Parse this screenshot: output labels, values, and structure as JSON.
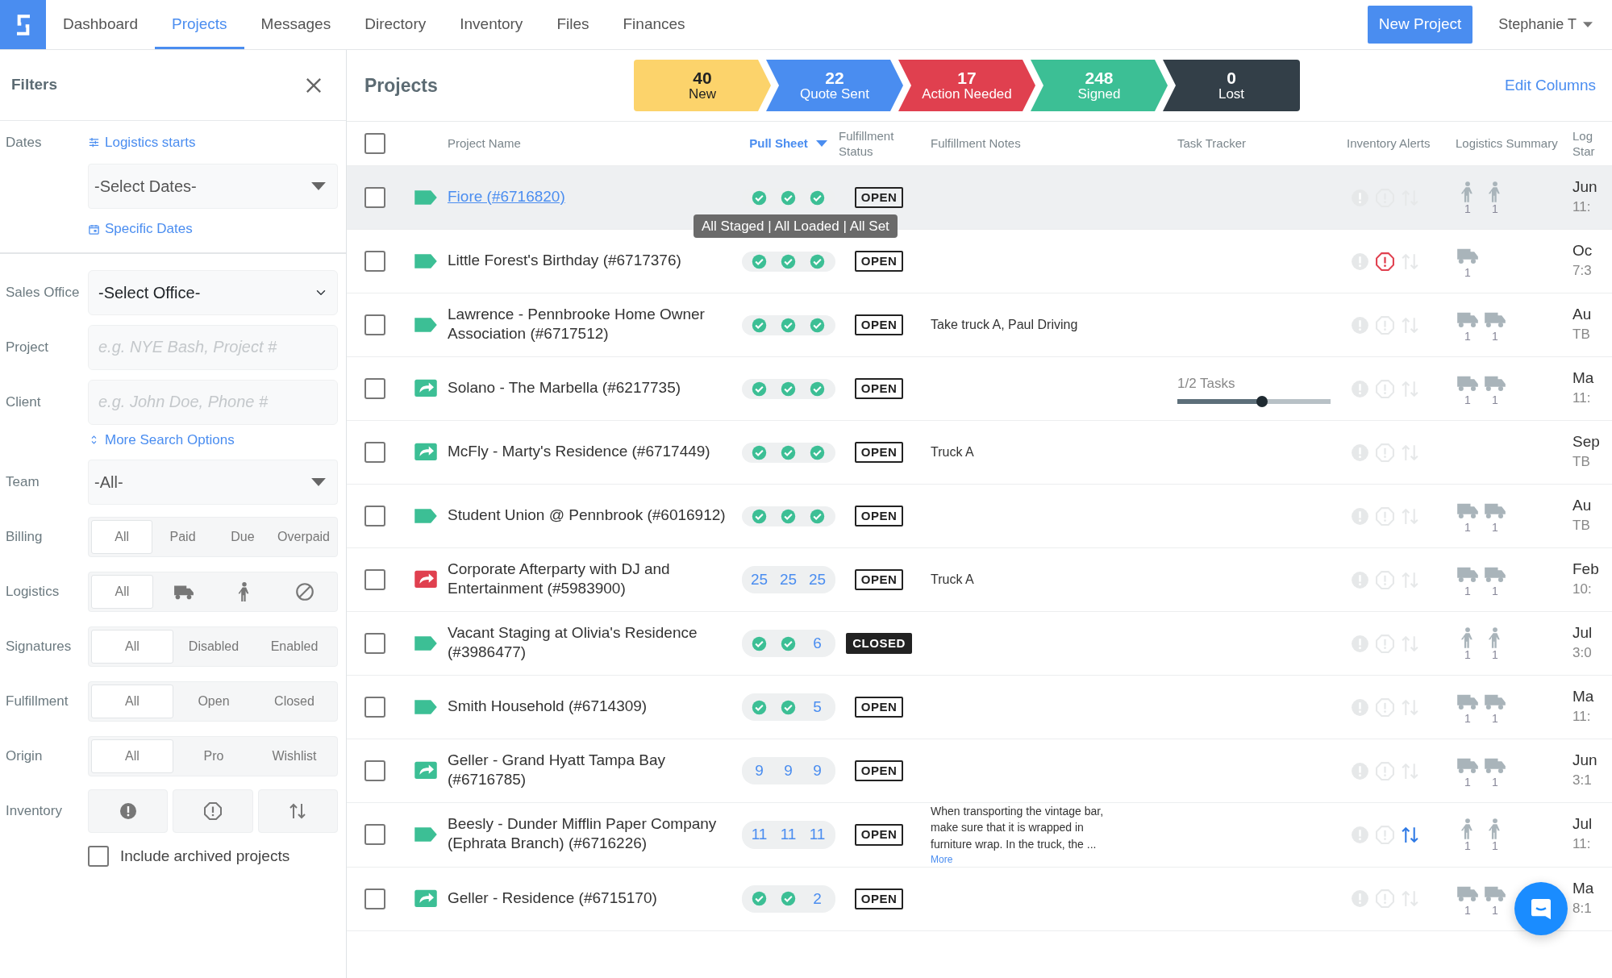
{
  "nav": {
    "tabs": [
      {
        "label": "Dashboard",
        "selected": false
      },
      {
        "label": "Projects",
        "selected": true
      },
      {
        "label": "Messages",
        "selected": false
      },
      {
        "label": "Directory",
        "selected": false
      },
      {
        "label": "Inventory",
        "selected": false
      },
      {
        "label": "Files",
        "selected": false
      },
      {
        "label": "Finances",
        "selected": false
      }
    ],
    "new_button": "New Project",
    "user": "Stephanie T"
  },
  "filters": {
    "title": "Filters",
    "dates": {
      "label": "Dates",
      "mode_link": "Logistics starts",
      "select": "-Select Dates-",
      "specific_link": "Specific Dates"
    },
    "sales_office": {
      "label": "Sales Office",
      "value": "-Select Office-"
    },
    "project": {
      "label": "Project",
      "placeholder": "e.g. NYE Bash, Project #"
    },
    "client": {
      "label": "Client",
      "placeholder": "e.g. John Doe, Phone #"
    },
    "more_link": "More Search Options",
    "team": {
      "label": "Team",
      "value": "-All-"
    },
    "segments": [
      {
        "label": "Billing",
        "options": [
          {
            "kind": "text",
            "label": "All",
            "selected": true
          },
          {
            "kind": "text",
            "label": "Paid",
            "selected": false
          },
          {
            "kind": "text",
            "label": "Due",
            "selected": false
          },
          {
            "kind": "text",
            "label": "Overpaid",
            "selected": false
          }
        ]
      },
      {
        "label": "Logistics",
        "options": [
          {
            "kind": "text",
            "label": "All",
            "selected": true
          },
          {
            "kind": "truck",
            "selected": false
          },
          {
            "kind": "walker",
            "selected": false
          },
          {
            "kind": "ban",
            "selected": false
          }
        ]
      },
      {
        "label": "Signatures",
        "options": [
          {
            "kind": "text",
            "label": "All",
            "selected": true
          },
          {
            "kind": "text",
            "label": "Disabled",
            "selected": false
          },
          {
            "kind": "text",
            "label": "Enabled",
            "selected": false
          }
        ]
      },
      {
        "label": "Fulfillment",
        "options": [
          {
            "kind": "text",
            "label": "All",
            "selected": true
          },
          {
            "kind": "text",
            "label": "Open",
            "selected": false
          },
          {
            "kind": "text",
            "label": "Closed",
            "selected": false
          }
        ]
      },
      {
        "label": "Origin",
        "options": [
          {
            "kind": "text",
            "label": "All",
            "selected": true
          },
          {
            "kind": "text",
            "label": "Pro",
            "selected": false
          },
          {
            "kind": "text",
            "label": "Wishlist",
            "selected": false
          }
        ]
      }
    ],
    "inventory": {
      "label": "Inventory",
      "buttons": [
        {
          "kind": "alert-filled"
        },
        {
          "kind": "alert-outline"
        },
        {
          "kind": "swap"
        }
      ]
    },
    "archived": {
      "label": "Include archived projects",
      "checked": false
    }
  },
  "main": {
    "title": "Projects",
    "edit_columns": "Edit Columns",
    "stages": [
      {
        "count": "40",
        "label": "New",
        "color": "#fcd36b"
      },
      {
        "count": "22",
        "label": "Quote Sent",
        "color": "#4a8df0"
      },
      {
        "count": "17",
        "label": "Action Needed",
        "color": "#e0404f"
      },
      {
        "count": "248",
        "label": "Signed",
        "color": "#3cbf95"
      },
      {
        "count": "0",
        "label": "Lost",
        "color": "#333f48"
      }
    ],
    "table": {
      "header_checked": false,
      "columns": [
        {
          "label": "Project Name",
          "sorted": false
        },
        {
          "label": "Pull Sheet",
          "sorted": true
        },
        {
          "label": "Fulfillment Status",
          "sorted": false
        },
        {
          "label": "Fulfillment Notes",
          "sorted": false
        },
        {
          "label": "Task Tracker",
          "sorted": false
        },
        {
          "label": "Inventory Alerts",
          "sorted": false
        },
        {
          "label": "Logistics Summary",
          "sorted": false
        },
        {
          "label": "Log Star",
          "sorted": false
        }
      ],
      "rows": [
        {
          "checked": false,
          "highlighted": true,
          "link": true,
          "kind": "tag",
          "color": "#3cbf95",
          "name": "Fiore (#6716820)",
          "pull": [
            {
              "kind": "check"
            },
            {
              "kind": "check"
            },
            {
              "kind": "check"
            }
          ],
          "tooltip": "All Staged | All Loaded | All Set",
          "status": "OPEN",
          "closed": false,
          "alerts": [
            {
              "active": false
            },
            {
              "active": false
            },
            {
              "active": false
            }
          ],
          "logistics": [
            {
              "kind": "walker",
              "count": "1"
            },
            {
              "kind": "walker",
              "count": "1"
            }
          ],
          "date": "Jun",
          "time": "11:"
        },
        {
          "checked": false,
          "highlighted": false,
          "link": false,
          "kind": "tag",
          "color": "#3cbf95",
          "name": "Little Forest's Birthday (#6717376)",
          "pull": [
            {
              "kind": "check"
            },
            {
              "kind": "check"
            },
            {
              "kind": "check"
            }
          ],
          "status": "OPEN",
          "closed": false,
          "alerts": [
            {
              "active": false
            },
            {
              "active": true
            },
            {
              "active": false
            }
          ],
          "logistics": [
            {
              "kind": "truck",
              "count": "1"
            }
          ],
          "date": "Oc",
          "time": "7:3"
        },
        {
          "checked": false,
          "highlighted": false,
          "link": false,
          "kind": "tag",
          "color": "#3cbf95",
          "name": "Lawrence - Pennbrooke Home Owner Association (#6717512)",
          "pull": [
            {
              "kind": "check"
            },
            {
              "kind": "check"
            },
            {
              "kind": "check"
            }
          ],
          "status": "OPEN",
          "closed": false,
          "notes": "Take truck A, Paul Driving",
          "alerts": [
            {
              "active": false
            },
            {
              "active": false
            },
            {
              "active": false
            }
          ],
          "logistics": [
            {
              "kind": "truck",
              "count": "1"
            },
            {
              "kind": "truck",
              "count": "1"
            }
          ],
          "date": "Au",
          "time": "TB"
        },
        {
          "checked": false,
          "highlighted": false,
          "link": false,
          "kind": "share",
          "color": "#3cbf95",
          "name": "Solano - The Marbella (#6217735)",
          "pull": [
            {
              "kind": "check"
            },
            {
              "kind": "check"
            },
            {
              "kind": "check"
            }
          ],
          "status": "OPEN",
          "closed": false,
          "tracker": {
            "label": "1/2 Tasks",
            "level": 0.55
          },
          "alerts": [
            {
              "active": false
            },
            {
              "active": false
            },
            {
              "active": false
            }
          ],
          "logistics": [
            {
              "kind": "truck",
              "count": "1"
            },
            {
              "kind": "truck",
              "count": "1"
            }
          ],
          "date": "Ma",
          "time": "11:"
        },
        {
          "checked": false,
          "highlighted": false,
          "link": false,
          "kind": "share",
          "color": "#3cbf95",
          "name": "McFly - Marty's Residence (#6717449)",
          "pull": [
            {
              "kind": "check"
            },
            {
              "kind": "check"
            },
            {
              "kind": "check"
            }
          ],
          "status": "OPEN",
          "closed": false,
          "notes": "Truck A",
          "alerts": [
            {
              "active": false
            },
            {
              "active": false
            },
            {
              "active": false
            }
          ],
          "logistics": [],
          "date": "Sep",
          "time": "TB"
        },
        {
          "checked": false,
          "highlighted": false,
          "link": false,
          "kind": "tag",
          "color": "#3cbf95",
          "name": "Student Union @ Pennbrook (#6016912)",
          "pull": [
            {
              "kind": "check"
            },
            {
              "kind": "check"
            },
            {
              "kind": "check"
            }
          ],
          "status": "OPEN",
          "closed": false,
          "alerts": [
            {
              "active": false
            },
            {
              "active": false
            },
            {
              "active": false
            }
          ],
          "logistics": [
            {
              "kind": "truck",
              "count": "1"
            },
            {
              "kind": "truck",
              "count": "1"
            }
          ],
          "date": "Au",
          "time": "TB"
        },
        {
          "checked": false,
          "highlighted": false,
          "link": false,
          "kind": "share",
          "color": "#e0404f",
          "name": "Corporate Afterparty with DJ and Entertainment (#5983900)",
          "pull": [
            {
              "kind": "count",
              "text": "25"
            },
            {
              "kind": "count",
              "text": "25"
            },
            {
              "kind": "count",
              "text": "25"
            }
          ],
          "status": "OPEN",
          "closed": false,
          "notes": "Truck A",
          "alerts": [
            {
              "active": false
            },
            {
              "active": false
            },
            {
              "active": false
            }
          ],
          "logistics": [
            {
              "kind": "truck",
              "count": "1"
            },
            {
              "kind": "truck",
              "count": "1"
            }
          ],
          "date": "Feb",
          "time": "10:"
        },
        {
          "checked": false,
          "highlighted": false,
          "link": false,
          "kind": "tag",
          "color": "#3cbf95",
          "name": "Vacant Staging at Olivia's Residence (#3986477)",
          "pull": [
            {
              "kind": "check"
            },
            {
              "kind": "check"
            },
            {
              "kind": "count",
              "text": "6"
            }
          ],
          "status": "CLOSED",
          "closed": true,
          "alerts": [
            {
              "active": false
            },
            {
              "active": false
            },
            {
              "active": false
            }
          ],
          "logistics": [
            {
              "kind": "walker",
              "count": "1"
            },
            {
              "kind": "walker",
              "count": "1"
            }
          ],
          "date": "Jul",
          "time": "3:0"
        },
        {
          "checked": false,
          "highlighted": false,
          "link": false,
          "kind": "tag",
          "color": "#3cbf95",
          "name": "Smith Household (#6714309)",
          "pull": [
            {
              "kind": "check"
            },
            {
              "kind": "check"
            },
            {
              "kind": "count",
              "text": "5"
            }
          ],
          "status": "OPEN",
          "closed": false,
          "alerts": [
            {
              "active": false
            },
            {
              "active": false
            },
            {
              "active": false
            }
          ],
          "logistics": [
            {
              "kind": "truck",
              "count": "1"
            },
            {
              "kind": "truck",
              "count": "1"
            }
          ],
          "date": "Ma",
          "time": "11:"
        },
        {
          "checked": false,
          "highlighted": false,
          "link": false,
          "kind": "share",
          "color": "#3cbf95",
          "name": "Geller - Grand Hyatt Tampa Bay (#6716785)",
          "pull": [
            {
              "kind": "count",
              "text": "9"
            },
            {
              "kind": "count",
              "text": "9"
            },
            {
              "kind": "count",
              "text": "9"
            }
          ],
          "status": "OPEN",
          "closed": false,
          "alerts": [
            {
              "active": false
            },
            {
              "active": false
            },
            {
              "active": false
            }
          ],
          "logistics": [
            {
              "kind": "truck",
              "count": "1"
            },
            {
              "kind": "truck",
              "count": "1"
            }
          ],
          "date": "Jun",
          "time": "3:1"
        },
        {
          "checked": false,
          "highlighted": false,
          "link": false,
          "kind": "tag",
          "color": "#3cbf95",
          "name": "Beesly - Dunder Mifflin Paper Company (Ephrata Branch) (#6716226)",
          "pull": [
            {
              "kind": "count",
              "text": "11"
            },
            {
              "kind": "count",
              "text": "11"
            },
            {
              "kind": "count",
              "text": "11"
            }
          ],
          "status": "OPEN",
          "closed": false,
          "notes": "When transporting the vintage bar, make sure that it is wrapped in furniture wrap. In the truck, the ...",
          "more": "More",
          "alerts": [
            {
              "active": false
            },
            {
              "active": false
            },
            {
              "active": true
            }
          ],
          "logistics": [
            {
              "kind": "walker",
              "count": "1"
            },
            {
              "kind": "walker",
              "count": "1"
            }
          ],
          "date": "Jul",
          "time": "11:"
        },
        {
          "checked": false,
          "highlighted": false,
          "link": false,
          "kind": "share",
          "color": "#3cbf95",
          "name": "Geller - Residence (#6715170)",
          "pull": [
            {
              "kind": "check"
            },
            {
              "kind": "check"
            },
            {
              "kind": "count",
              "text": "2"
            }
          ],
          "status": "OPEN",
          "closed": false,
          "alerts": [
            {
              "active": false
            },
            {
              "active": false
            },
            {
              "active": false
            }
          ],
          "logistics": [
            {
              "kind": "truck",
              "count": "1"
            },
            {
              "kind": "truck",
              "count": "1"
            }
          ],
          "date": "Ma",
          "time": "8:1"
        }
      ]
    }
  }
}
